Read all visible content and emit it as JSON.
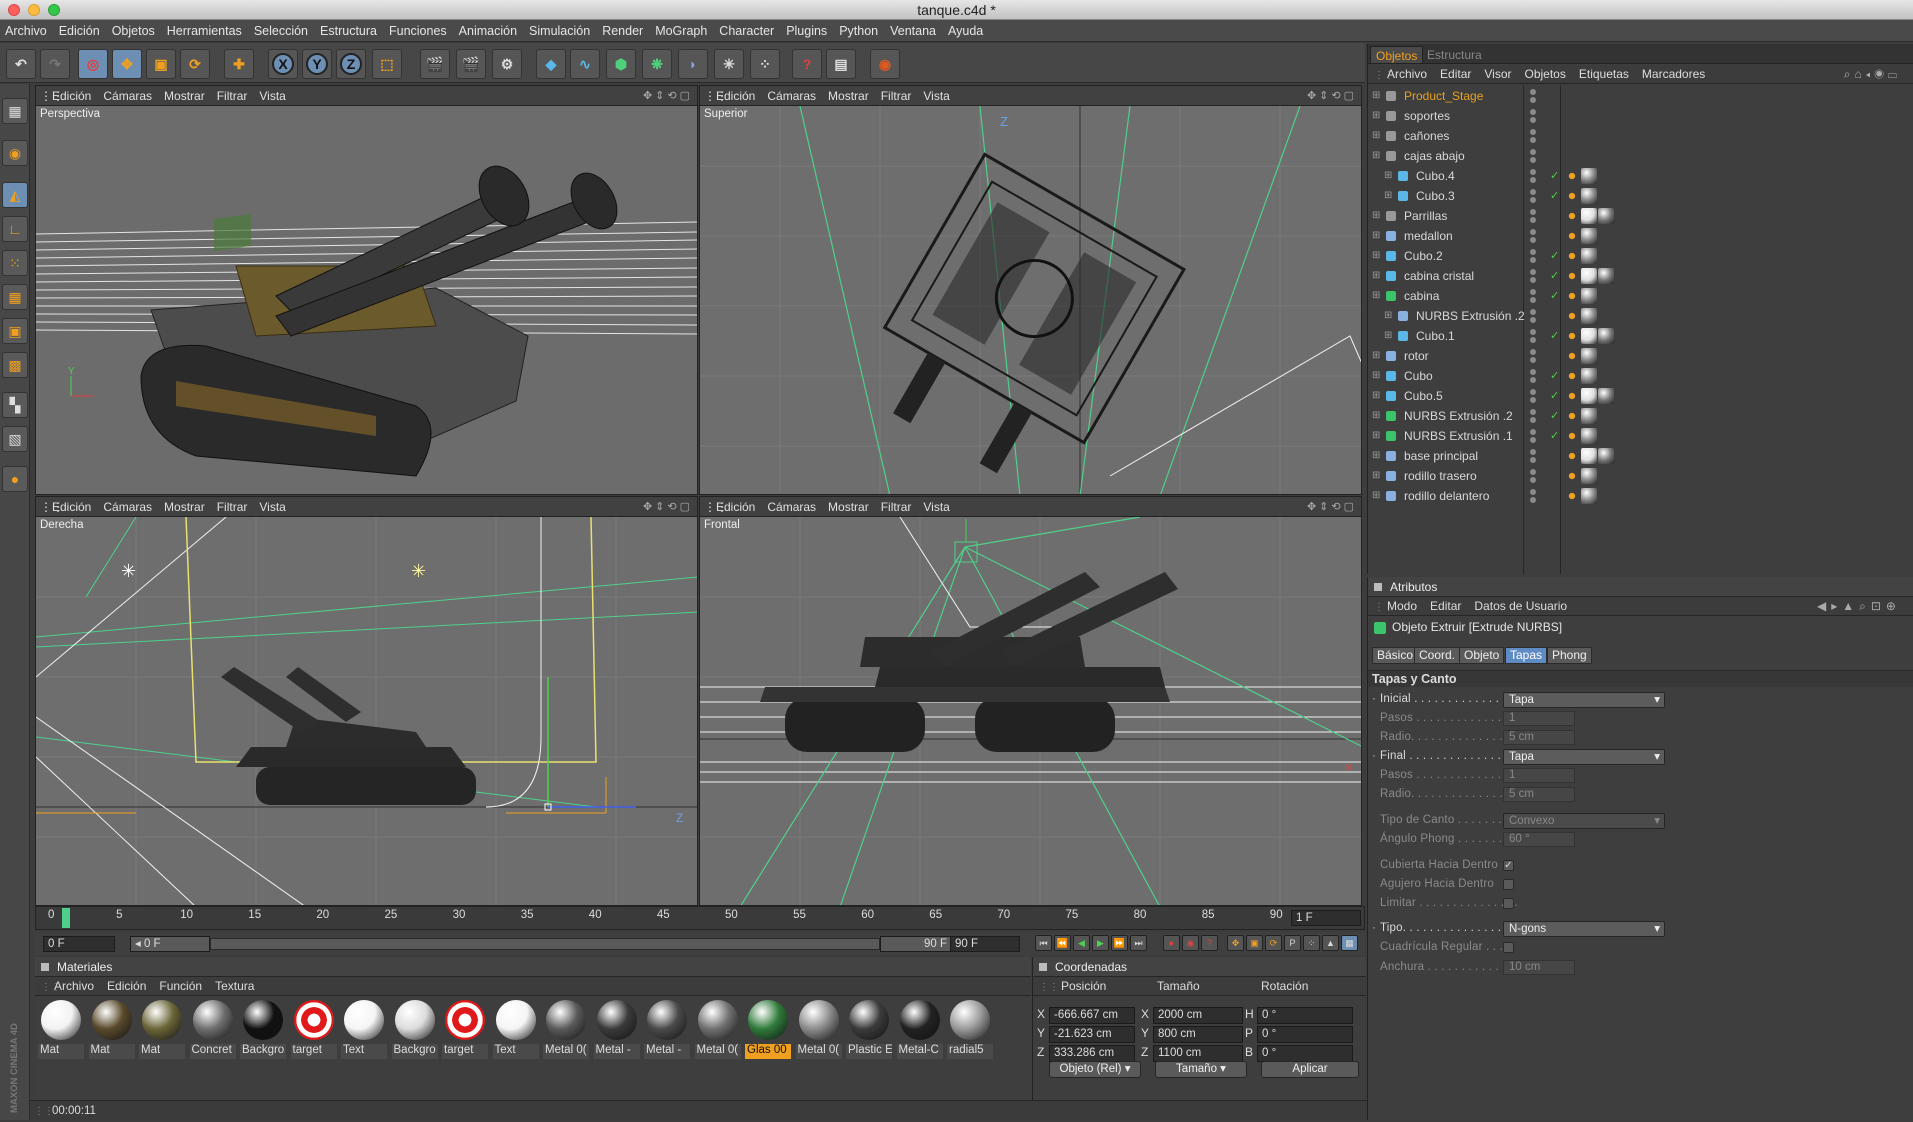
{
  "window": {
    "title": "tanque.c4d *"
  },
  "menubar": [
    "Archivo",
    "Edición",
    "Objetos",
    "Herramientas",
    "Selección",
    "Estructura",
    "Funciones",
    "Animación",
    "Simulación",
    "Render",
    "MoGraph",
    "Character",
    "Plugins",
    "Python",
    "Ventana",
    "Ayuda"
  ],
  "toolbar": {
    "axis_x": "X",
    "axis_y": "Y",
    "axis_z": "Z"
  },
  "viewport_menu": [
    "Edición",
    "Cámaras",
    "Mostrar",
    "Filtrar",
    "Vista"
  ],
  "viewports": [
    {
      "label": "Perspectiva"
    },
    {
      "label": "Superior"
    },
    {
      "label": "Derecha"
    },
    {
      "label": "Frontal"
    }
  ],
  "axis_letters": {
    "y": "Y",
    "z": "Z"
  },
  "timeline": {
    "ticks": [
      "0",
      "5",
      "10",
      "15",
      "20",
      "25",
      "30",
      "35",
      "40",
      "45",
      "50",
      "55",
      "60",
      "65",
      "70",
      "75",
      "80",
      "85",
      "90"
    ],
    "current_frame": "1 F",
    "start_field": "0 F",
    "range_start": "◂ 0 F",
    "range_end": "90 F ▸",
    "end_field": "90 F",
    "playhead_value": 1
  },
  "materials": {
    "title": "Materiales",
    "menu": [
      "Archivo",
      "Edición",
      "Función",
      "Textura"
    ],
    "items": [
      {
        "label": "Mat",
        "color": "#f2f2f2",
        "highlight": false
      },
      {
        "label": "Mat",
        "color": "#5a4a2c",
        "highlight": false
      },
      {
        "label": "Mat",
        "color": "#6b6638",
        "highlight": false
      },
      {
        "label": "Concret",
        "color": "#6e6e6e",
        "highlight": false
      },
      {
        "label": "Backgro",
        "color": "#111111",
        "highlight": false
      },
      {
        "label": "target",
        "color": "#e01a1a",
        "highlight": false
      },
      {
        "label": "Text",
        "color": "#f5f5f5",
        "highlight": false
      },
      {
        "label": "Backgro",
        "color": "#dcdcdc",
        "highlight": false
      },
      {
        "label": "target",
        "color": "#e01a1a",
        "highlight": false
      },
      {
        "label": "Text",
        "color": "#f5f5f5",
        "highlight": false
      },
      {
        "label": "Metal 0(",
        "color": "#5a5a5a",
        "highlight": false
      },
      {
        "label": "Metal -",
        "color": "#3a3a3a",
        "highlight": false
      },
      {
        "label": "Metal -",
        "color": "#4a4a4a",
        "highlight": false
      },
      {
        "label": "Metal 0(",
        "color": "#707070",
        "highlight": false
      },
      {
        "label": "Glas 00",
        "color": "#2f7a3a",
        "highlight": true
      },
      {
        "label": "Metal 0(",
        "color": "#8c8c8c",
        "highlight": false
      },
      {
        "label": "Plastic E",
        "color": "#3b3b3b",
        "highlight": false
      },
      {
        "label": "Metal-C",
        "color": "#222222",
        "highlight": false
      },
      {
        "label": "radial5",
        "color": "#9a9a9a",
        "highlight": false
      }
    ]
  },
  "coordinates": {
    "title": "Coordenadas",
    "col_headers": [
      "Posición",
      "Tamaño",
      "Rotación"
    ],
    "rows": [
      {
        "axis": "X",
        "pos": "-666.667 cm",
        "size_axis": "X",
        "size": "2000 cm",
        "rot_axis": "H",
        "rot": "0 °"
      },
      {
        "axis": "Y",
        "pos": "-21.623 cm",
        "size_axis": "Y",
        "size": "800 cm",
        "rot_axis": "P",
        "rot": "0 °"
      },
      {
        "axis": "Z",
        "pos": "333.286 cm",
        "size_axis": "Z",
        "size": "1100 cm",
        "rot_axis": "B",
        "rot": "0 °"
      }
    ],
    "mode": "Objeto (Rel)",
    "size_mode": "Tamaño",
    "apply": "Aplicar"
  },
  "status": {
    "time": "00:00:11"
  },
  "objects_panel": {
    "tabs": [
      "Objetos",
      "Estructura"
    ],
    "menu": [
      "Archivo",
      "Editar",
      "Visor",
      "Objetos",
      "Etiquetas",
      "Marcadores"
    ],
    "rows": [
      {
        "name": "Product_Stage",
        "indent": 0,
        "icon": "null",
        "color": "#e8a020",
        "check": false
      },
      {
        "name": "soportes",
        "indent": 0,
        "icon": "null",
        "color": "#d8d8d8",
        "check": false
      },
      {
        "name": "cañones",
        "indent": 0,
        "icon": "null",
        "color": "#d8d8d8",
        "check": false
      },
      {
        "name": "cajas abajo",
        "indent": 0,
        "icon": "null",
        "color": "#d8d8d8",
        "check": false
      },
      {
        "name": "Cubo.4",
        "indent": 1,
        "icon": "cube",
        "color": "#d8d8d8",
        "check": true
      },
      {
        "name": "Cubo.3",
        "indent": 1,
        "icon": "cube",
        "color": "#d8d8d8",
        "check": true
      },
      {
        "name": "Parrillas",
        "indent": 0,
        "icon": "null",
        "color": "#d8d8d8",
        "check": false
      },
      {
        "name": "medallon",
        "indent": 0,
        "icon": "poly",
        "color": "#d8d8d8",
        "check": false
      },
      {
        "name": "Cubo.2",
        "indent": 0,
        "icon": "cube",
        "color": "#d8d8d8",
        "check": true
      },
      {
        "name": "cabina cristal",
        "indent": 0,
        "icon": "cube",
        "color": "#d8d8d8",
        "check": true
      },
      {
        "name": "cabina",
        "indent": 0,
        "icon": "nurbs",
        "color": "#d8d8d8",
        "check": true
      },
      {
        "name": "NURBS Extrusión .2",
        "indent": 1,
        "icon": "poly",
        "color": "#d8d8d8",
        "check": false
      },
      {
        "name": "Cubo.1",
        "indent": 1,
        "icon": "cube",
        "color": "#d8d8d8",
        "check": true
      },
      {
        "name": "rotor",
        "indent": 0,
        "icon": "poly",
        "color": "#d8d8d8",
        "check": false
      },
      {
        "name": "Cubo",
        "indent": 0,
        "icon": "cube",
        "color": "#d8d8d8",
        "check": true
      },
      {
        "name": "Cubo.5",
        "indent": 0,
        "icon": "cube",
        "color": "#d8d8d8",
        "check": true
      },
      {
        "name": "NURBS Extrusión .2",
        "indent": 0,
        "icon": "nurbs",
        "color": "#d8d8d8",
        "check": true
      },
      {
        "name": "NURBS Extrusión .1",
        "indent": 0,
        "icon": "nurbs",
        "color": "#d8d8d8",
        "check": true
      },
      {
        "name": "base principal",
        "indent": 0,
        "icon": "poly",
        "color": "#d8d8d8",
        "check": false
      },
      {
        "name": "rodillo trasero",
        "indent": 0,
        "icon": "poly",
        "color": "#d8d8d8",
        "check": false
      },
      {
        "name": "rodillo delantero",
        "indent": 0,
        "icon": "poly",
        "color": "#d8d8d8",
        "check": false
      }
    ]
  },
  "attributes": {
    "title": "Atributos",
    "menu": [
      "Modo",
      "Editar",
      "Datos de Usuario"
    ],
    "object_title": "Objeto Extruir [Extrude NURBS]",
    "tabs": [
      "Básico",
      "Coord.",
      "Objeto",
      "Tapas",
      "Phong"
    ],
    "active_tab": "Tapas",
    "section": "Tapas y Canto",
    "fields": {
      "inicial": {
        "label": "Inicial . . . . . . . . . . . . . . .",
        "value": "Tapa"
      },
      "pasos1": {
        "label": "Pasos . . . . . . . . . . . . . . .",
        "value": "1"
      },
      "radio1": {
        "label": "Radio. . . . . . . . . . . . . . . .",
        "value": "5 cm"
      },
      "final": {
        "label": "Final . . . . . . . . . . . . . . . .",
        "value": "Tapa"
      },
      "pasos2": {
        "label": "Pasos . . . . . . . . . . . . . . .",
        "value": "1"
      },
      "radio2": {
        "label": "Radio. . . . . . . . . . . . . . . .",
        "value": "5 cm"
      },
      "tipo_canto": {
        "label": "Tipo de Canto . . . . . . . .",
        "value": "Convexo"
      },
      "angulo_phong": {
        "label": "Ángulo Phong . . . . . . . .",
        "value": "60 °"
      },
      "cubierta": {
        "label": "Cubierta Hacia Dentro",
        "value": "✓"
      },
      "agujero": {
        "label": "Agujero Hacia Dentro",
        "value": ""
      },
      "limitar": {
        "label": "Limitar . . . . . . . . . . . . . . .",
        "value": ""
      },
      "tipo": {
        "label": "Tipo. . . . . . . . . . . . . . . . .",
        "value": "N-gons"
      },
      "cuadricula": {
        "label": "Cuadrícula Regular . . .",
        "value": ""
      },
      "anchura": {
        "label": "Anchura . . . . . . . . . . . . . .",
        "value": "10 cm"
      }
    }
  },
  "brand": {
    "text": "MAXON CINEMA 4D"
  }
}
